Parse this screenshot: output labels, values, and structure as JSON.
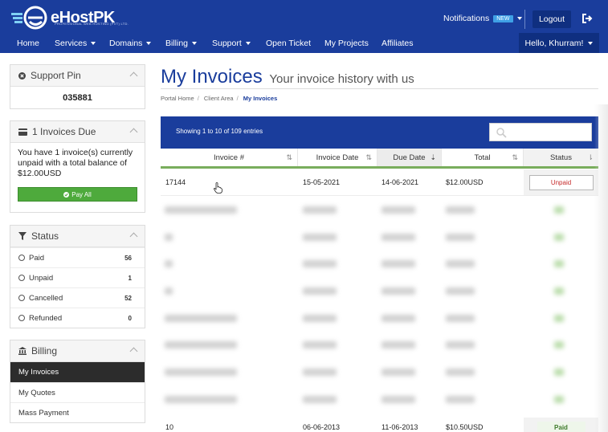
{
  "brand": {
    "name": "eHostPK",
    "tagline": "PROFESSIONAL WEB HOSTING (PVT) LTD."
  },
  "header": {
    "notifications_label": "Notifications",
    "notifications_badge": "NEW",
    "logout_label": "Logout",
    "greeting": "Hello, Khurram!"
  },
  "nav": {
    "items": [
      {
        "label": "Home"
      },
      {
        "label": "Services"
      },
      {
        "label": "Domains"
      },
      {
        "label": "Billing"
      },
      {
        "label": "Support"
      },
      {
        "label": "Open Ticket"
      },
      {
        "label": "My Projects"
      },
      {
        "label": "Affiliates"
      }
    ]
  },
  "sidebar": {
    "support_pin": {
      "title": "Support Pin",
      "value": "035881"
    },
    "invoices_due": {
      "title": "1 Invoices Due",
      "text": "You have 1 invoice(s) currently unpaid with a total balance of $12.00USD",
      "button": "Pay All"
    },
    "status": {
      "title": "Status",
      "items": [
        {
          "label": "Paid",
          "count": "56"
        },
        {
          "label": "Unpaid",
          "count": "1"
        },
        {
          "label": "Cancelled",
          "count": "52"
        },
        {
          "label": "Refunded",
          "count": "0"
        }
      ]
    },
    "billing": {
      "title": "Billing",
      "items": [
        {
          "label": "My Invoices"
        },
        {
          "label": "My Quotes"
        },
        {
          "label": "Mass Payment"
        }
      ]
    }
  },
  "main": {
    "title": "My Invoices",
    "subtitle": "Your invoice history with us",
    "breadcrumb": [
      "Portal Home",
      "Client Area",
      "My Invoices"
    ],
    "entries_info": "Showing 1 to 10 of 109 entries",
    "columns": [
      "Invoice #",
      "Invoice Date",
      "Due Date",
      "Total",
      "Status"
    ],
    "rows": [
      {
        "invoice": "17144",
        "invoice_date": "15-05-2021",
        "due_date": "14-06-2021",
        "total": "$12.00USD",
        "status": "Unpaid"
      },
      {
        "invoice": "10",
        "invoice_date": "06-06-2013",
        "due_date": "11-06-2013",
        "total": "$10.50USD",
        "status": "Paid"
      }
    ]
  },
  "colors": {
    "brand_blue": "#1a3d9c",
    "dark_blue": "#0f2f80",
    "pay_green": "#4eaa3c",
    "unpaid_red": "#c62a2a"
  }
}
